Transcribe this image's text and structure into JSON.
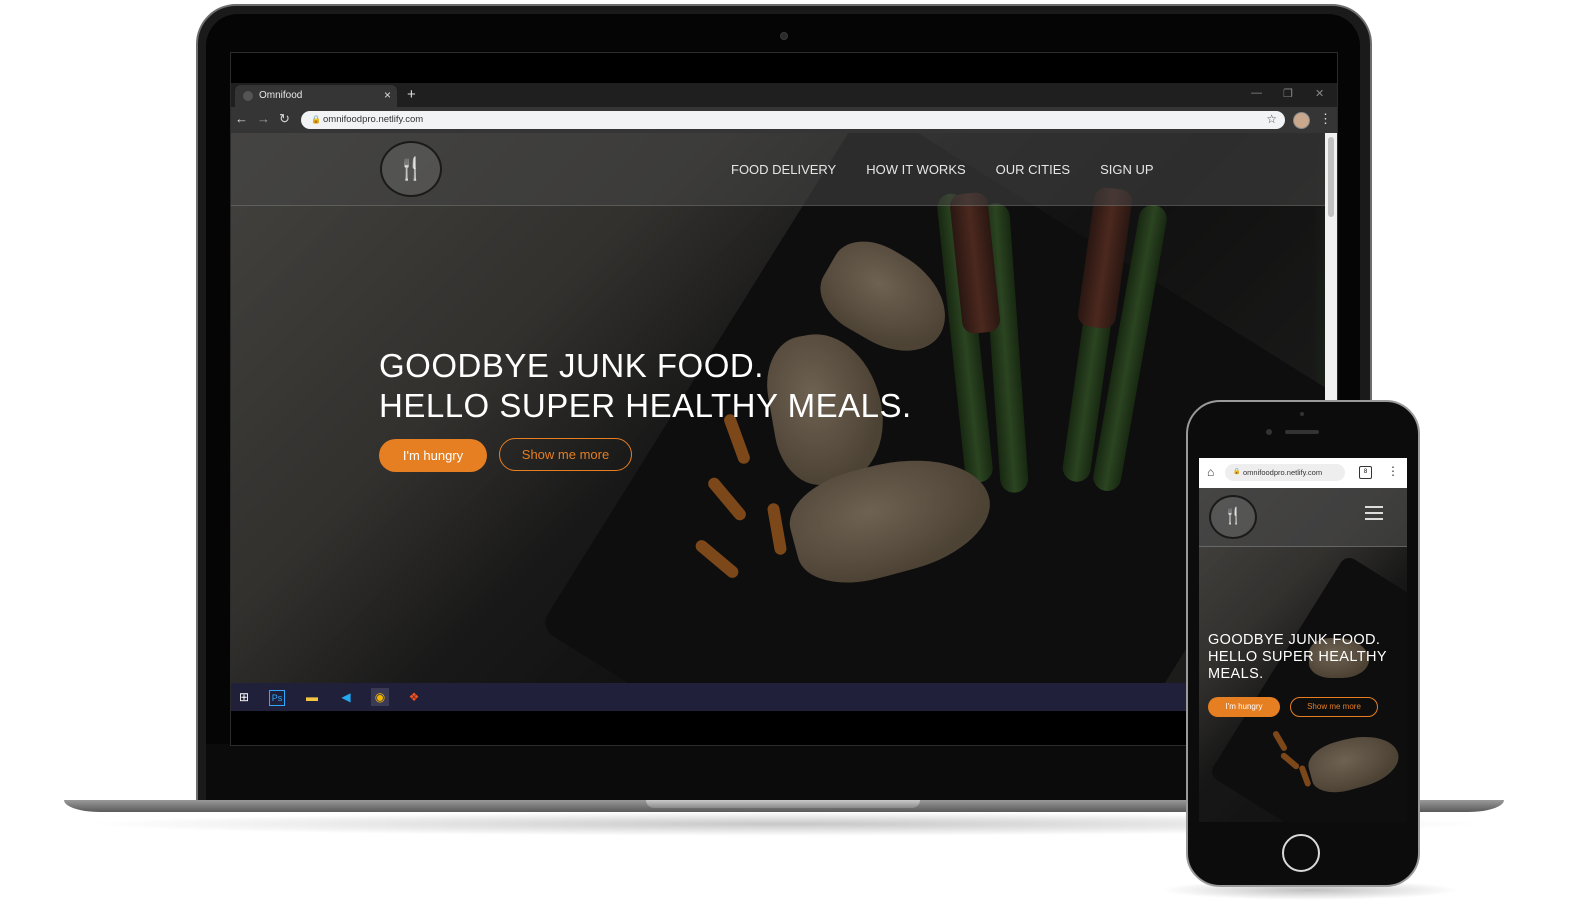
{
  "browser": {
    "tab_title": "Omnifood",
    "tab_close": "×",
    "new_tab": "+",
    "url": "omnifoodpro.netlify.com",
    "window_controls": [
      "—",
      "❐",
      "✕"
    ],
    "back": "←",
    "forward": "→",
    "reload": "↻",
    "star": "☆",
    "menu": "⋮"
  },
  "site": {
    "logo_glyph": "🍴",
    "nav": [
      "FOOD DELIVERY",
      "HOW IT WORKS",
      "OUR CITIES",
      "SIGN UP"
    ],
    "hero_line1": "GOODBYE JUNK FOOD.",
    "hero_line2": "HELLO SUPER HEALTHY MEALS.",
    "primary_button": "I'm hungry",
    "secondary_button": "Show me more",
    "accent_color": "#e67e22"
  },
  "taskbar": {
    "items": [
      {
        "name": "windows-start-icon",
        "glyph": "⊞",
        "color": "#ffffff"
      },
      {
        "name": "photoshop-icon",
        "glyph": "Ps",
        "color": "#31a8ff"
      },
      {
        "name": "file-explorer-icon",
        "glyph": "▬",
        "color": "#f4c542"
      },
      {
        "name": "vscode-icon",
        "glyph": "◀",
        "color": "#23a9f2"
      },
      {
        "name": "chrome-icon",
        "glyph": "◉",
        "color": "#f2b600"
      },
      {
        "name": "figma-icon",
        "glyph": "❖",
        "color": "#f24e1e"
      }
    ]
  },
  "phone": {
    "url": "omnifoodpro.netlify.com",
    "home_glyph": "⌂",
    "tabs_count": "8",
    "menu": "⋮",
    "logo_glyph": "🍴",
    "hero_line1": "GOODBYE JUNK FOOD.",
    "hero_line2": "HELLO SUPER HEALTHY",
    "hero_line3": "MEALS.",
    "primary_button": "I'm hungry",
    "secondary_button": "Show me more"
  }
}
